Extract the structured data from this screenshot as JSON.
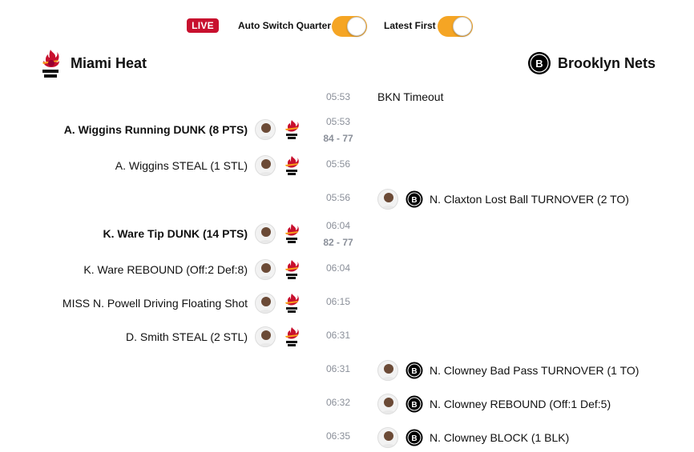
{
  "header": {
    "live_label": "LIVE",
    "auto_switch_label": "Auto Switch Quarter",
    "latest_first_label": "Latest First",
    "auto_switch_on": true,
    "latest_first_on": true,
    "toggle_color": "#f5a524",
    "live_color": "#c8102e"
  },
  "teams": {
    "home": {
      "name": "Miami Heat",
      "logo_icon": "heat-logo-icon"
    },
    "away": {
      "name": "Brooklyn Nets",
      "logo_icon": "nets-logo-icon"
    }
  },
  "events": [
    {
      "side": "away",
      "time": "05:53",
      "text": "BKN Timeout",
      "bold": false,
      "score": ""
    },
    {
      "side": "home",
      "time": "05:53",
      "text": "A. Wiggins Running DUNK (8 PTS)",
      "bold": true,
      "score": "84 - 77"
    },
    {
      "side": "home",
      "time": "05:56",
      "text": "A. Wiggins STEAL (1 STL)",
      "bold": false,
      "score": ""
    },
    {
      "side": "away",
      "time": "05:56",
      "text": "N. Claxton Lost Ball TURNOVER (2 TO)",
      "bold": false,
      "score": ""
    },
    {
      "side": "home",
      "time": "06:04",
      "text": "K. Ware Tip DUNK (14 PTS)",
      "bold": true,
      "score": "82 - 77"
    },
    {
      "side": "home",
      "time": "06:04",
      "text": "K. Ware REBOUND (Off:2 Def:8)",
      "bold": false,
      "score": ""
    },
    {
      "side": "home",
      "time": "06:15",
      "text": "MISS N. Powell Driving Floating Shot",
      "bold": false,
      "score": ""
    },
    {
      "side": "home",
      "time": "06:31",
      "text": "D. Smith STEAL (2 STL)",
      "bold": false,
      "score": ""
    },
    {
      "side": "away",
      "time": "06:31",
      "text": "N. Clowney Bad Pass TURNOVER (1 TO)",
      "bold": false,
      "score": ""
    },
    {
      "side": "away",
      "time": "06:32",
      "text": "N. Clowney REBOUND (Off:1 Def:5)",
      "bold": false,
      "score": ""
    },
    {
      "side": "away",
      "time": "06:35",
      "text": "N. Clowney BLOCK (1 BLK)",
      "bold": false,
      "score": ""
    }
  ]
}
